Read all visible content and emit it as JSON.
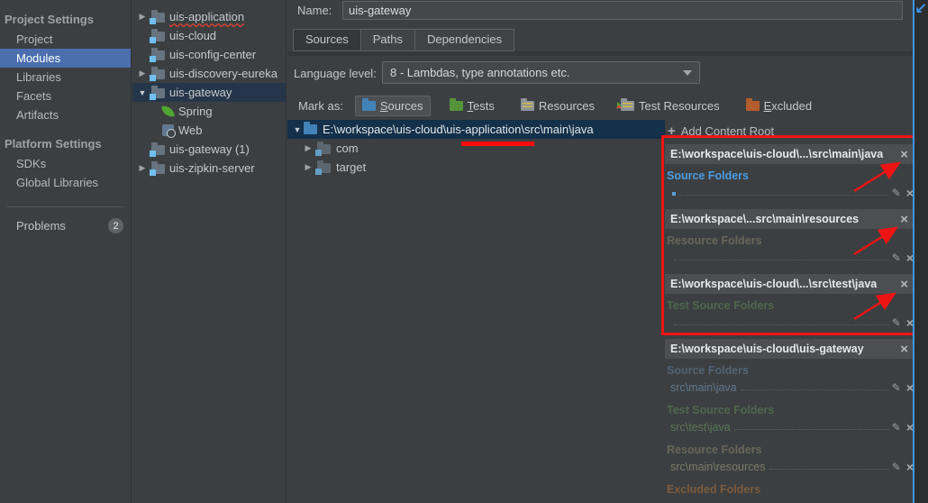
{
  "sidebar": {
    "sections": [
      {
        "header": "Project Settings",
        "items": [
          "Project",
          "Modules",
          "Libraries",
          "Facets",
          "Artifacts"
        ]
      },
      {
        "header": "Platform Settings",
        "items": [
          "SDKs",
          "Global Libraries"
        ]
      }
    ],
    "selected_item": "Modules",
    "problems": {
      "label": "Problems",
      "count": "2"
    }
  },
  "module_tree": {
    "items": [
      {
        "label": "uis-application",
        "state": "collapsible",
        "error": true
      },
      {
        "label": "uis-cloud"
      },
      {
        "label": "uis-config-center"
      },
      {
        "label": "uis-discovery-eureka",
        "state": "collapsible"
      },
      {
        "label": "uis-gateway",
        "state": "expanded",
        "selected": true
      },
      {
        "label": "Spring",
        "icon": "spring-icon"
      },
      {
        "label": "Web",
        "icon": "web-icon"
      },
      {
        "label": "uis-gateway (1)"
      },
      {
        "label": "uis-zipkin-server",
        "state": "collapsible"
      }
    ]
  },
  "editor": {
    "name_label": "Name:",
    "name_value": "uis-gateway",
    "tabs": [
      "Sources",
      "Paths",
      "Dependencies"
    ],
    "selected_tab": "Sources",
    "language_level": {
      "label": "Language level:",
      "value": "8 - Lambdas, type annotations etc."
    },
    "mark_as": {
      "label": "Mark as:",
      "buttons": [
        {
          "u": "S",
          "rest": "ources",
          "icon": "sources-folder-icon",
          "selected": true
        },
        {
          "u": "T",
          "rest": "ests",
          "icon": "tests-folder-icon"
        },
        {
          "u": "",
          "rest": "Resources",
          "icon": "resources-folder-icon"
        },
        {
          "u": "",
          "rest": "Test Resources",
          "icon": "test-resources-folder-icon"
        },
        {
          "u": "E",
          "rest": "xcluded",
          "icon": "excluded-folder-icon"
        }
      ]
    },
    "content_tree": {
      "root_path": "E:\\workspace\\uis-cloud\\uis-application\\src\\main\\java",
      "children": [
        "com",
        "target"
      ]
    }
  },
  "content_roots": {
    "add": {
      "plus": "+",
      "pre": "Add ",
      "u": "C",
      "rest": "ontent Root"
    },
    "groups": [
      {
        "path": "E:\\workspace\\uis-cloud\\...\\src\\main\\java",
        "section_title": "Source Folders"
      },
      {
        "path": "E:\\workspace\\...src\\main\\resources",
        "section_title": "Resource Folders"
      },
      {
        "path": "E:\\workspace\\uis-cloud\\...\\src\\test\\java",
        "section_title": "Test Source Folders"
      },
      {
        "path": "E:\\workspace\\uis-cloud\\uis-gateway",
        "sections": [
          {
            "title": "Source Folders",
            "value": "src\\main\\java"
          },
          {
            "title": "Test Source Folders",
            "value": "src\\test\\java"
          },
          {
            "title": "Resource Folders",
            "value": "src\\main\\resources"
          },
          {
            "title": "Excluded Folders"
          }
        ]
      }
    ]
  },
  "icons": {
    "close": "×",
    "edit": "✎",
    "collapsed": "▶",
    "expanded": "▼",
    "plus": "+",
    "jump_arrow": "↙"
  },
  "colors": {
    "panel_bg": "#3c3f41",
    "sidebar_selection": "#4b6eaf",
    "tree_selection": "#26364a",
    "path_row_selection": "#14304b",
    "header_strip": "#4b4f51",
    "source_folders_blue": "#4f9de2",
    "annotation_red": "#ee1414",
    "edge_blue": "#3d96e8"
  }
}
